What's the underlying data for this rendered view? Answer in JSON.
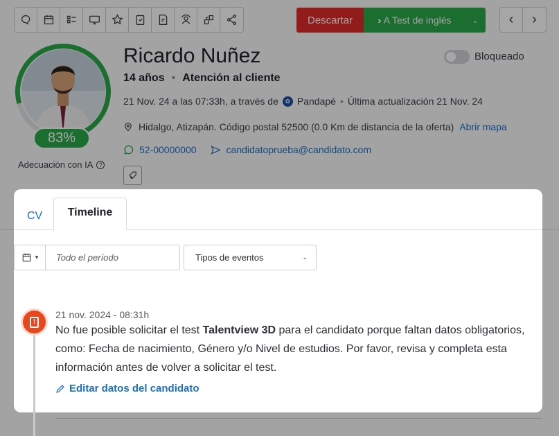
{
  "toolbar": {
    "icons": [
      "chat-icon",
      "calendar-icon",
      "list-icon",
      "monitor-icon",
      "star-icon",
      "clipboard-icon",
      "document-check-icon",
      "contacts-icon",
      "transfer-icon",
      "share-icon"
    ]
  },
  "actions": {
    "discard_label": "Descartar",
    "next_label": "A Test de inglés",
    "prev_arrow": "‹",
    "next_arrow": "›"
  },
  "candidate": {
    "name": "Ricardo Nuñez",
    "age": "14 años",
    "area": "Atención al cliente",
    "applied_text": "21 Nov. 24 a las 07:33h, a través de",
    "source": "Pandapé",
    "updated_text": "Última actualización 21 Nov. 24",
    "address": "Hidalgo, Atizapán. Código postal 52500 (0.0 Km de distancia de la oferta)",
    "map_link": "Abrir mapa",
    "phone": "52-00000000",
    "email": "candidatoprueba@candidato.com",
    "score": "83%",
    "score_value": 0.83,
    "ia_label": "Adecuación con IA",
    "blocked_label": "Bloqueado",
    "blocked": false
  },
  "colors": {
    "green": "#2aa84a",
    "red": "#e02b2b",
    "blue": "#1b6fc0",
    "alert_orange": "#e8461d"
  },
  "modal": {
    "tabs": [
      {
        "label": "CV",
        "active": false
      },
      {
        "label": "Timeline",
        "active": true
      }
    ],
    "filters": {
      "period_placeholder": "Todo el período",
      "event_types": "Tipos de eventos"
    },
    "event": {
      "date": "21 nov. 2024 - 08:31h",
      "msg_before": "No fue posible solicitar el test ",
      "msg_bold": "Talentview 3D",
      "msg_after": " para el candidato porque faltan datos obligatorios, como: Fecha de nacimiento, Género y/o Nivel de estudios. Por favor, revisa y completa esta información antes de volver a solicitar el test.",
      "edit_link": "Editar datos del candidato"
    }
  }
}
